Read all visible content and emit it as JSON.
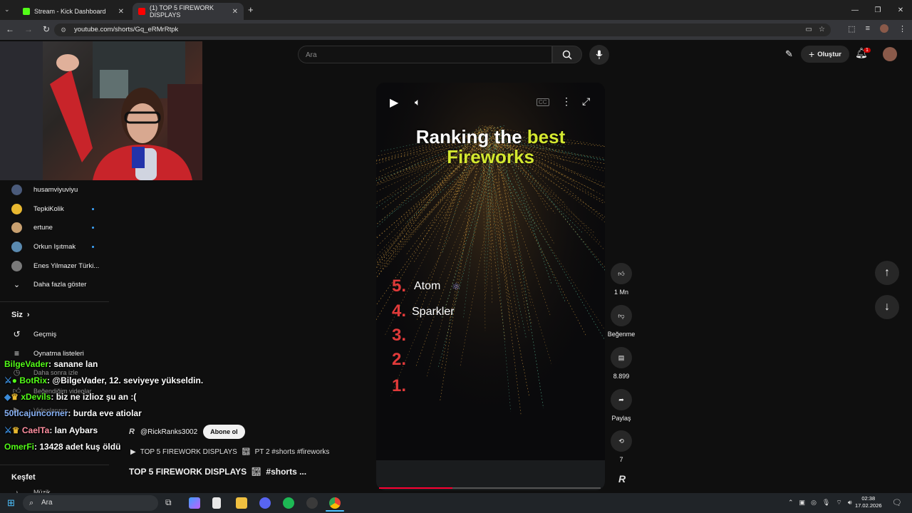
{
  "tabs": [
    {
      "label": "Stream - Kick Dashboard",
      "favicon_color": "#53fc18"
    },
    {
      "label": "(1) TOP 5 FIREWORK DISPLAYS",
      "favicon_color": "#ff0000"
    }
  ],
  "address": {
    "url": "youtube.com/shorts/Gq_eRMrRtpk"
  },
  "header": {
    "search_placeholder": "Ara",
    "create_label": "Oluştur",
    "notif_count": "1"
  },
  "sidebar": {
    "subscriptions": [
      {
        "label": "husamviyuviyu",
        "avatar_color": "#4a5a7a",
        "new": false
      },
      {
        "label": "TepkiKolik",
        "avatar_color": "#e8b830",
        "new": true
      },
      {
        "label": "ertune",
        "avatar_color": "#c8a070",
        "new": true
      },
      {
        "label": "Orkun Işıtmak",
        "avatar_color": "#5a8ab0",
        "new": true
      },
      {
        "label": "Enes Yilmazer Türki...",
        "avatar_color": "#7a7a7a",
        "new": false
      }
    ],
    "show_more": "Daha fazla göster",
    "you_heading": "Siz",
    "you_items": [
      "Geçmiş",
      "Oynatma listeleri",
      "Daha sonra izle",
      "Beğendiğim videolar",
      "Videolarınız"
    ],
    "explore_heading": "Keşfet",
    "explore_first": "Müzik"
  },
  "video": {
    "title_line1": "Ranking the",
    "title_highlight1": "best",
    "title_line2": "Fireworks",
    "ranks": [
      {
        "num": "5.",
        "name": "Atom"
      },
      {
        "num": "4.",
        "name": "Sparkler"
      },
      {
        "num": "3.",
        "name": ""
      },
      {
        "num": "2.",
        "name": ""
      },
      {
        "num": "1.",
        "name": ""
      }
    ],
    "progress": 0.33,
    "channel": "@RickRanks3002",
    "subscribe": "Abone ol",
    "playlist_line": "TOP 5 FIREWORK DISPLAYS",
    "playlist_suffix": "PT 2 #shorts #fireworks",
    "caption_title": "TOP 5 FIREWORK DISPLAYS",
    "caption_suffix": "#shorts ..."
  },
  "actions": {
    "like_count": "1 Mn",
    "dislike_label": "Beğenme",
    "comments_count": "8.899",
    "share_label": "Paylaş",
    "remix_count": "7"
  },
  "chat": [
    {
      "user": "BilgeVader",
      "user_color": "#53fc18",
      "msg": ": sanane lan"
    },
    {
      "user": "BotRix",
      "user_color": "#53fc18",
      "msg": ": @BilgeVader, 12. seviyeye yükseldin."
    },
    {
      "user": "xDevils",
      "user_color": "#53fc18",
      "msg": ": biz ne izlioz şu an :("
    },
    {
      "user": "50tlcajuncorner",
      "user_color": "#8ab4f8",
      "msg": ": burda eve atiolar"
    },
    {
      "user": "CaelTa",
      "user_color": "#ff8fa0",
      "msg": ": lan Aybars"
    },
    {
      "user": "OmerFi",
      "user_color": "#53fc18",
      "msg": ": 13428 adet kuş öldü"
    }
  ],
  "taskbar": {
    "search": "Ara",
    "time": "02:38",
    "date": "17.02.2026"
  }
}
